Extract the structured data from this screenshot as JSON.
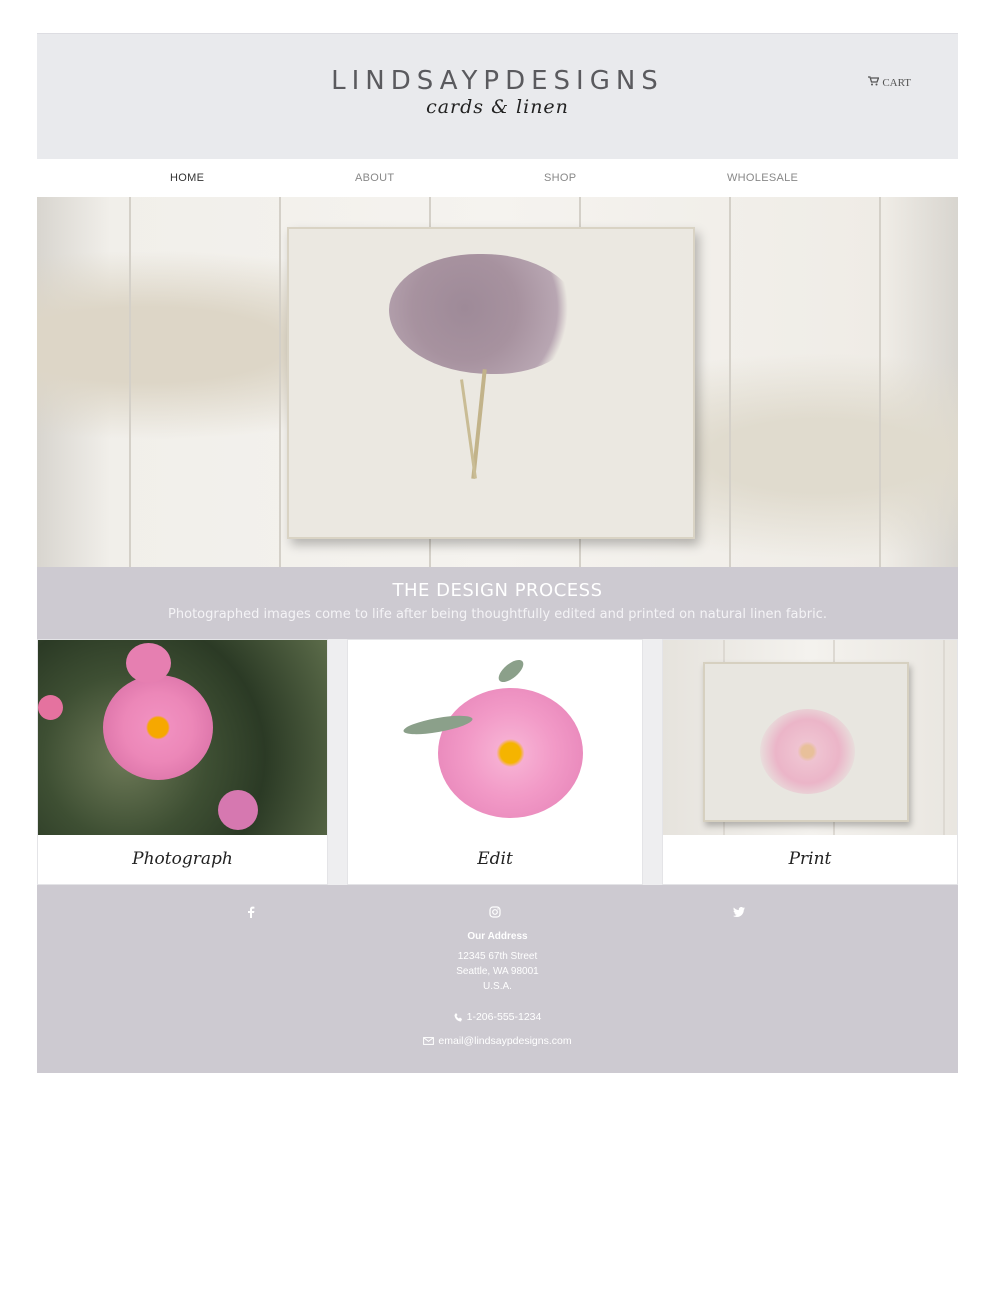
{
  "header": {
    "logo_main": "LINDSAYPDESIGNS",
    "logo_sub": "cards & linen",
    "cart_label": "CART"
  },
  "nav": {
    "items": [
      {
        "label": "HOME",
        "active": true
      },
      {
        "label": "ABOUT",
        "active": false
      },
      {
        "label": "SHOP",
        "active": false
      },
      {
        "label": "WHOLESALE",
        "active": false
      }
    ]
  },
  "hero": {
    "image": "linen-card-hydrangea"
  },
  "design_process": {
    "title": "THE DESIGN PROCESS",
    "description": "Photographed images come to life after being thoughtfully edited and printed on natural linen fabric."
  },
  "steps": [
    {
      "caption": "Photograph",
      "image": "camellia-photo"
    },
    {
      "caption": "Edit",
      "image": "camellia-edited"
    },
    {
      "caption": "Print",
      "image": "camellia-linen-print"
    }
  ],
  "footer": {
    "social": [
      {
        "icon": "facebook-icon"
      },
      {
        "icon": "instagram-icon"
      },
      {
        "icon": "twitter-icon"
      }
    ],
    "address_title": "Our Address",
    "address_lines": [
      "12345 67th Street",
      "Seattle, WA 98001",
      "U.S.A."
    ],
    "phone": "1-206-555-1234",
    "email": "email@lindsaypdesigns.com"
  },
  "colors": {
    "header_bg": "#e9eaed",
    "band_bg": "#cdcad1",
    "text_muted": "#888888"
  }
}
